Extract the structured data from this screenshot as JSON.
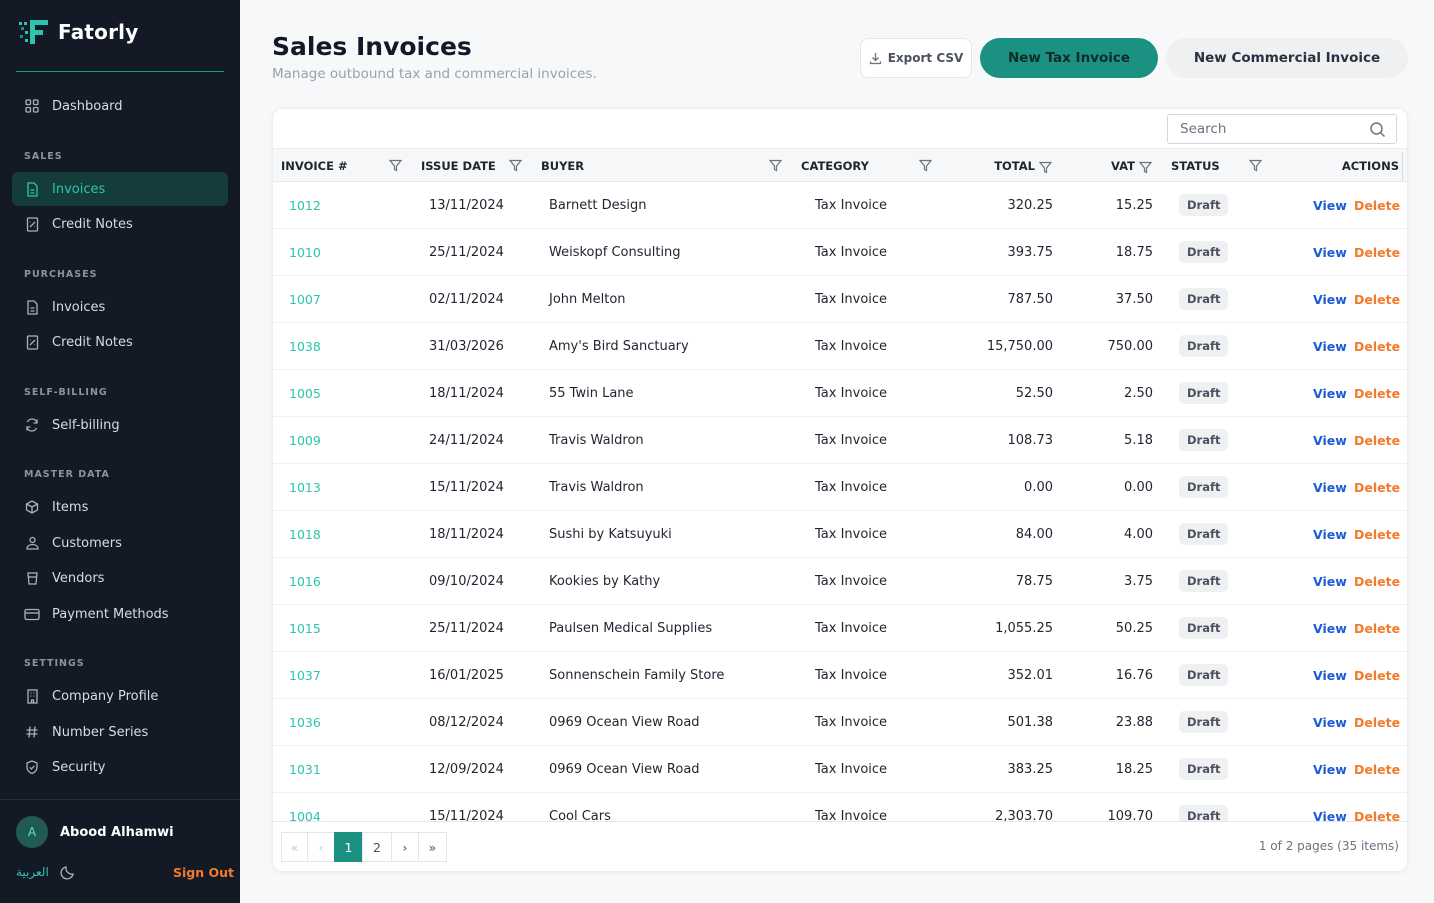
{
  "brand": {
    "name": "Fatorly"
  },
  "sidebar": {
    "dashboard": "Dashboard",
    "sections": {
      "sales": "SALES",
      "purchases": "PURCHASES",
      "self_billing": "SELF-BILLING",
      "master_data": "MASTER DATA",
      "settings": "SETTINGS"
    },
    "sales_items": [
      "Invoices",
      "Credit Notes"
    ],
    "purchase_items": [
      "Invoices",
      "Credit Notes"
    ],
    "self_billing_items": [
      "Self-billing"
    ],
    "master_items": [
      "Items",
      "Customers",
      "Vendors",
      "Payment Methods"
    ],
    "settings_items": [
      "Company Profile",
      "Number Series",
      "Security"
    ]
  },
  "user": {
    "initial": "A",
    "name": "Abood Alhamwi",
    "language": "العربية",
    "sign_out": "Sign Out"
  },
  "header": {
    "title": "Sales Invoices",
    "subtitle": "Manage outbound tax and commercial invoices.",
    "export_label": "Export CSV",
    "new_tax_label": "New Tax Invoice",
    "new_commercial_label": "New Commercial Invoice"
  },
  "search": {
    "placeholder": "Search"
  },
  "table": {
    "columns": [
      "INVOICE #",
      "ISSUE DATE",
      "BUYER",
      "CATEGORY",
      "TOTAL",
      "VAT",
      "STATUS",
      "ACTIONS"
    ],
    "action_view": "View",
    "action_delete": "Delete",
    "rows": [
      {
        "invoice": "1012",
        "date": "13/11/2024",
        "buyer": "Barnett Design",
        "category": "Tax Invoice",
        "total": "320.25",
        "vat": "15.25",
        "status": "Draft"
      },
      {
        "invoice": "1010",
        "date": "25/11/2024",
        "buyer": "Weiskopf Consulting",
        "category": "Tax Invoice",
        "total": "393.75",
        "vat": "18.75",
        "status": "Draft"
      },
      {
        "invoice": "1007",
        "date": "02/11/2024",
        "buyer": "John Melton",
        "category": "Tax Invoice",
        "total": "787.50",
        "vat": "37.50",
        "status": "Draft"
      },
      {
        "invoice": "1038",
        "date": "31/03/2026",
        "buyer": "Amy's Bird Sanctuary",
        "category": "Tax Invoice",
        "total": "15,750.00",
        "vat": "750.00",
        "status": "Draft"
      },
      {
        "invoice": "1005",
        "date": "18/11/2024",
        "buyer": "55 Twin Lane",
        "category": "Tax Invoice",
        "total": "52.50",
        "vat": "2.50",
        "status": "Draft"
      },
      {
        "invoice": "1009",
        "date": "24/11/2024",
        "buyer": "Travis Waldron",
        "category": "Tax Invoice",
        "total": "108.73",
        "vat": "5.18",
        "status": "Draft"
      },
      {
        "invoice": "1013",
        "date": "15/11/2024",
        "buyer": "Travis Waldron",
        "category": "Tax Invoice",
        "total": "0.00",
        "vat": "0.00",
        "status": "Draft"
      },
      {
        "invoice": "1018",
        "date": "18/11/2024",
        "buyer": "Sushi by Katsuyuki",
        "category": "Tax Invoice",
        "total": "84.00",
        "vat": "4.00",
        "status": "Draft"
      },
      {
        "invoice": "1016",
        "date": "09/10/2024",
        "buyer": "Kookies by Kathy",
        "category": "Tax Invoice",
        "total": "78.75",
        "vat": "3.75",
        "status": "Draft"
      },
      {
        "invoice": "1015",
        "date": "25/11/2024",
        "buyer": "Paulsen Medical Supplies",
        "category": "Tax Invoice",
        "total": "1,055.25",
        "vat": "50.25",
        "status": "Draft"
      },
      {
        "invoice": "1037",
        "date": "16/01/2025",
        "buyer": "Sonnenschein Family Store",
        "category": "Tax Invoice",
        "total": "352.01",
        "vat": "16.76",
        "status": "Draft"
      },
      {
        "invoice": "1036",
        "date": "08/12/2024",
        "buyer": "0969 Ocean View Road",
        "category": "Tax Invoice",
        "total": "501.38",
        "vat": "23.88",
        "status": "Draft"
      },
      {
        "invoice": "1031",
        "date": "12/09/2024",
        "buyer": "0969 Ocean View Road",
        "category": "Tax Invoice",
        "total": "383.25",
        "vat": "18.25",
        "status": "Draft"
      },
      {
        "invoice": "1004",
        "date": "15/11/2024",
        "buyer": "Cool Cars",
        "category": "Tax Invoice",
        "total": "2,303.70",
        "vat": "109.70",
        "status": "Draft"
      }
    ]
  },
  "pagination": {
    "first": "«",
    "prev": "‹",
    "pages": [
      "1",
      "2"
    ],
    "next": "›",
    "last": "»",
    "info": "1 of 2 pages (35 items)"
  }
}
